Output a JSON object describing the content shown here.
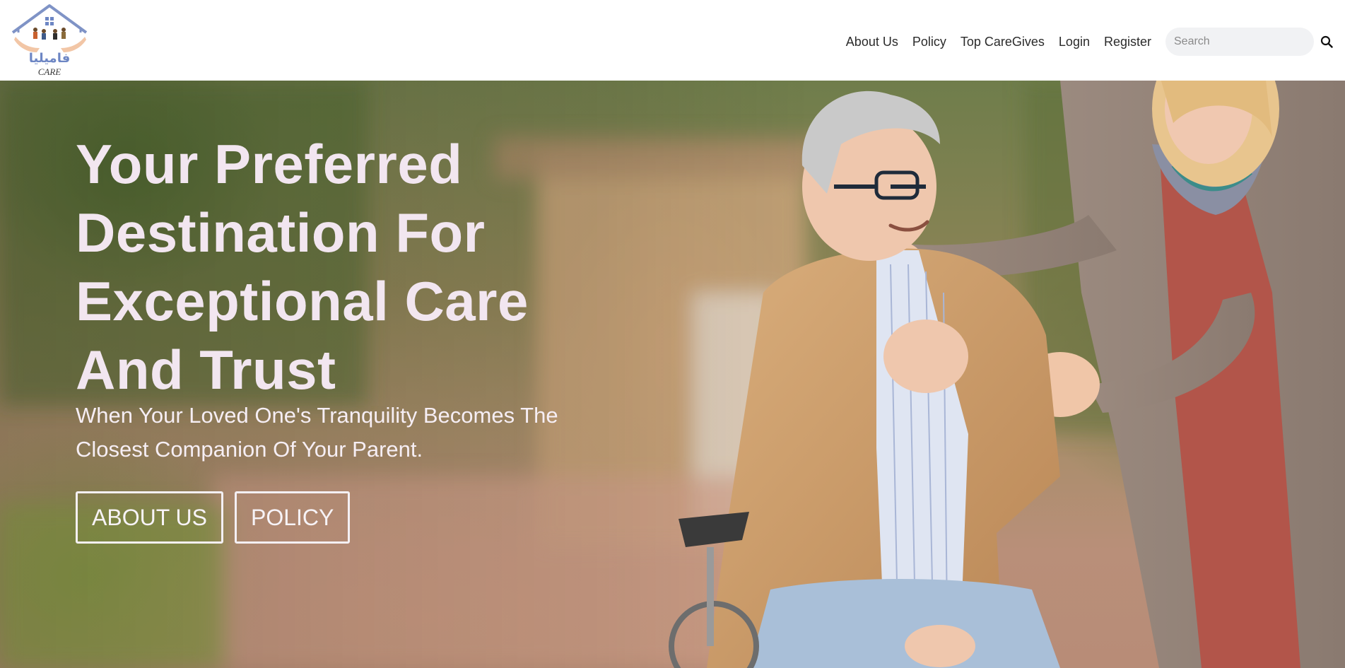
{
  "header": {
    "logo": {
      "arabic_text": "فاميليا",
      "latin_text": "CARE"
    },
    "nav": [
      {
        "label": "About Us"
      },
      {
        "label": "Policy"
      },
      {
        "label": "Top CareGives"
      },
      {
        "label": "Login"
      },
      {
        "label": "Register"
      }
    ],
    "search": {
      "placeholder": "Search",
      "value": ""
    }
  },
  "hero": {
    "title": "Your Preferred Destination For Exceptional Care And Trust",
    "subtitle": "When Your Loved One's Tranquility Becomes The Closest Companion Of Your Parent.",
    "buttons": [
      {
        "label": "ABOUT US"
      },
      {
        "label": "POLICY"
      }
    ]
  },
  "colors": {
    "accent_blue": "#6d86c4",
    "hero_text": "#f2e6f0",
    "nav_text": "#2b2b2b"
  }
}
